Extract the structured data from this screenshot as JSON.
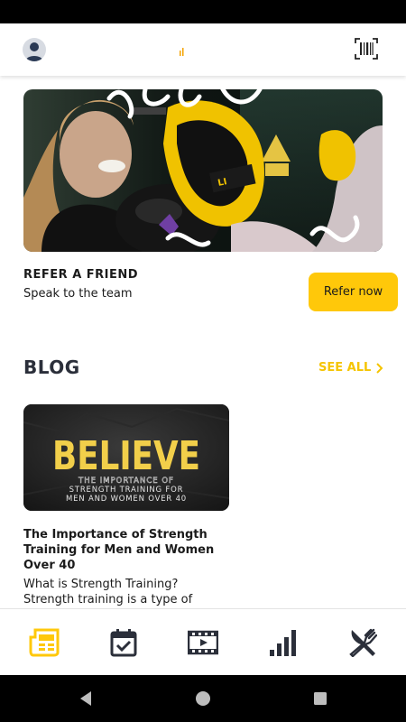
{
  "refer": {
    "title": "REFER A FRIEND",
    "subtitle": "Speak to the team",
    "button_label": "Refer now"
  },
  "blog": {
    "heading": "BLOG",
    "see_all_label": "SEE ALL",
    "post": {
      "image_headline": "BELIEVE",
      "image_subline_1": "THE IMPORTANCE OF",
      "image_subline_2": "STRENGTH TRAINING FOR",
      "image_subline_3": "MEN AND WOMEN OVER 40",
      "title": "The Importance of Strength Training for Men and Women Over 40",
      "excerpt": "What is Strength Training? Strength training is a type of"
    }
  },
  "bottom_nav": {
    "items": [
      {
        "icon": "news-icon",
        "active": true
      },
      {
        "icon": "calendar-check-icon",
        "active": false
      },
      {
        "icon": "video-icon",
        "active": false
      },
      {
        "icon": "bar-chart-icon",
        "active": false
      },
      {
        "icon": "fork-knife-icon",
        "active": false
      }
    ]
  },
  "colors": {
    "accent": "#ffc80a",
    "see_all": "#f5c400",
    "nav_icon": "#2b2f3a"
  }
}
